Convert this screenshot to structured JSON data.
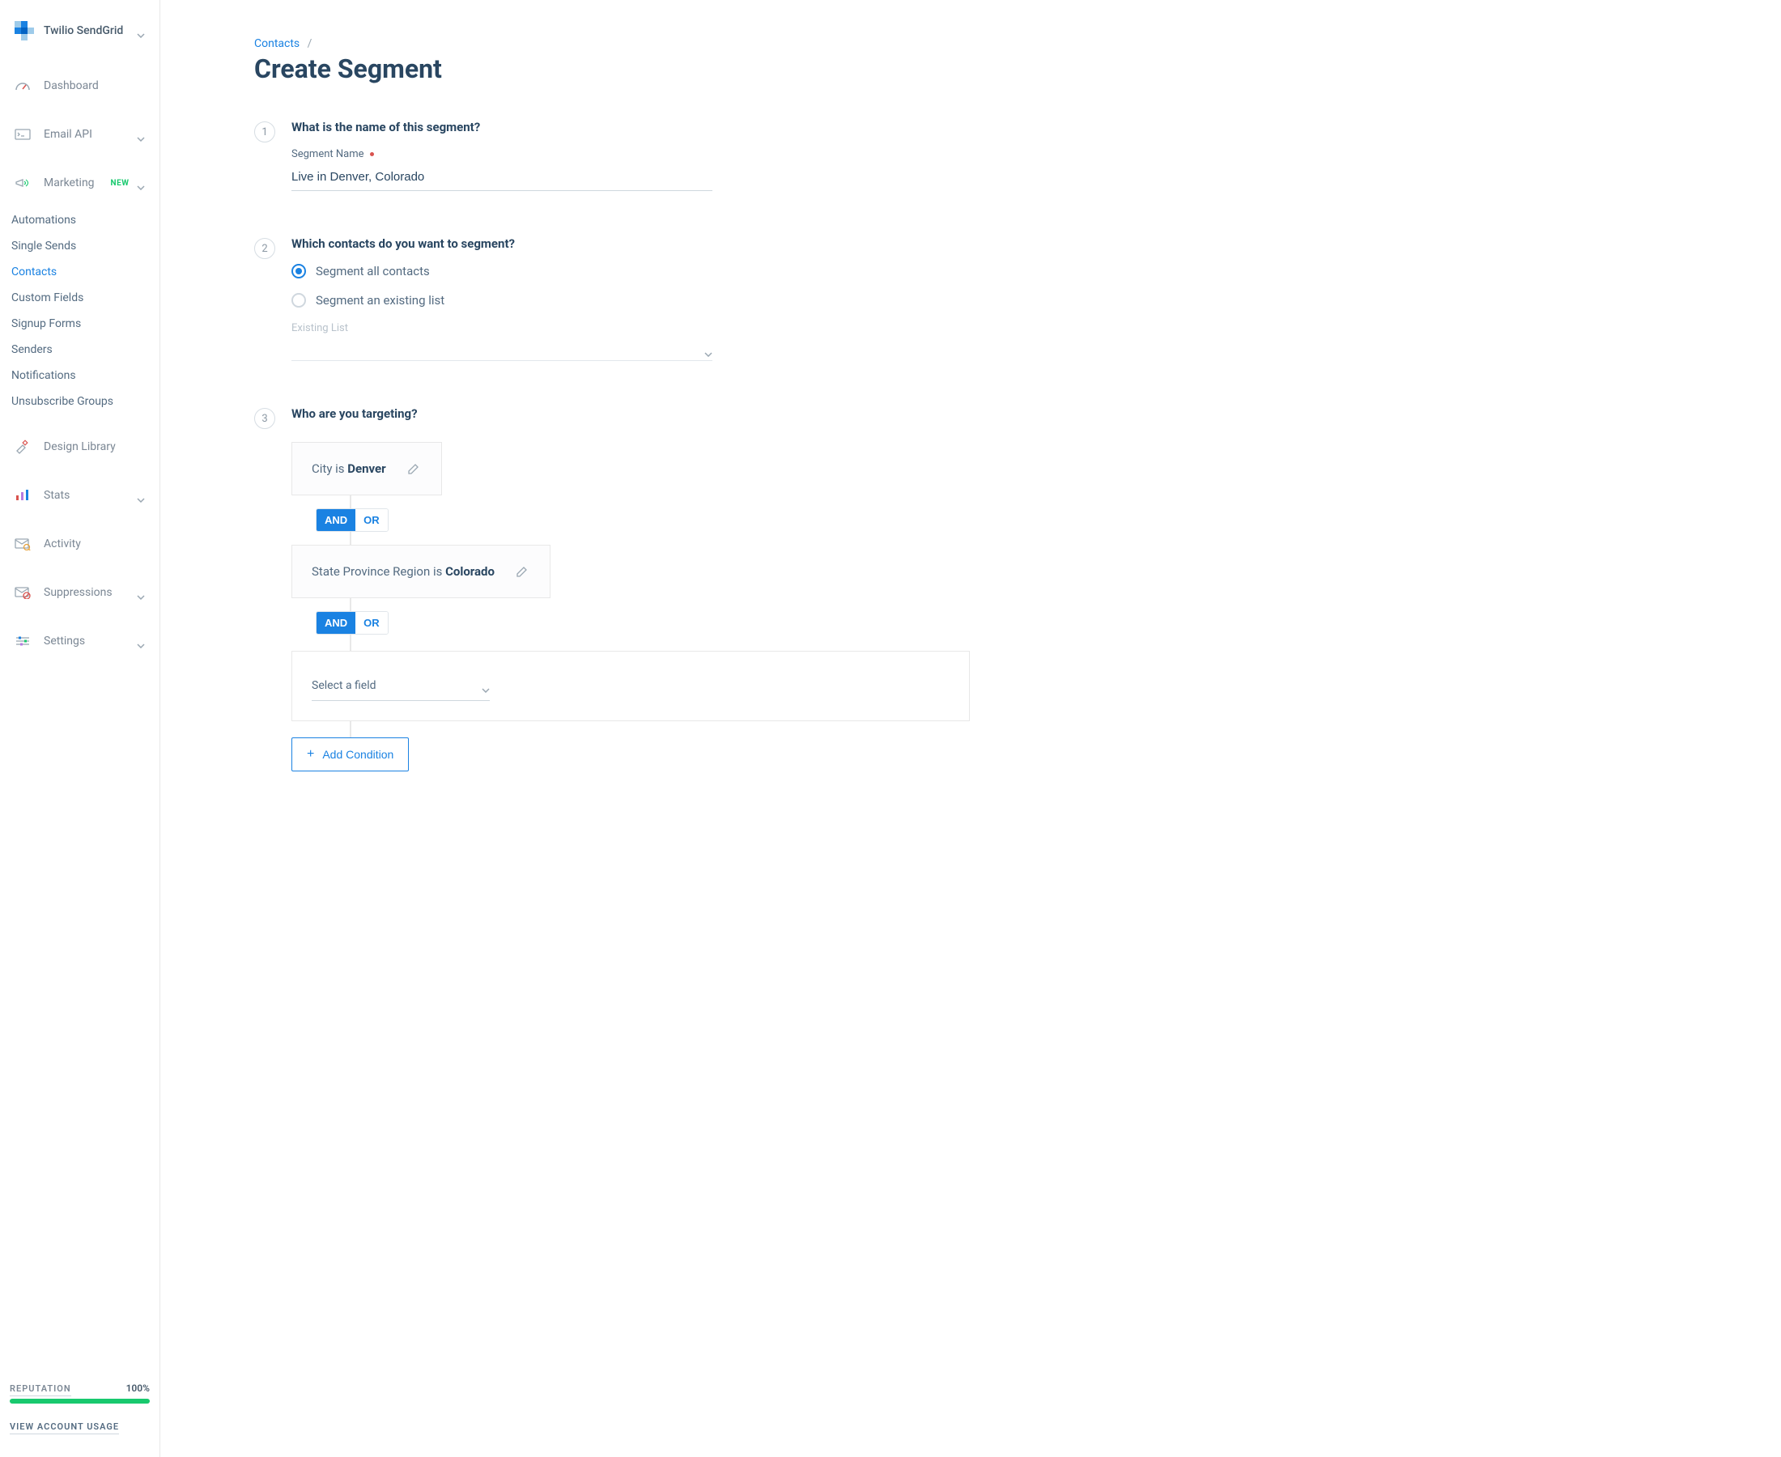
{
  "brand": {
    "name": "Twilio SendGrid"
  },
  "nav": {
    "dashboard": "Dashboard",
    "emailApi": "Email API",
    "marketing": "Marketing",
    "marketingBadge": "NEW",
    "designLibrary": "Design Library",
    "stats": "Stats",
    "activity": "Activity",
    "suppressions": "Suppressions",
    "settings": "Settings"
  },
  "subnav": {
    "automations": "Automations",
    "singleSends": "Single Sends",
    "contacts": "Contacts",
    "customFields": "Custom Fields",
    "signupForms": "Signup Forms",
    "senders": "Senders",
    "notifications": "Notifications",
    "unsubscribeGroups": "Unsubscribe Groups"
  },
  "footer": {
    "reputationLabel": "REPUTATION",
    "reputationPct": "100%",
    "usageLink": "VIEW ACCOUNT USAGE"
  },
  "breadcrumb": {
    "link": "Contacts",
    "sep": "/"
  },
  "pageTitle": "Create Segment",
  "step1": {
    "num": "1",
    "title": "What is the name of this segment?",
    "fieldLabel": "Segment Name",
    "value": "Live in Denver, Colorado"
  },
  "step2": {
    "num": "2",
    "title": "Which contacts do you want to segment?",
    "optAll": "Segment all contacts",
    "optExisting": "Segment an existing list",
    "existingListLabel": "Existing List"
  },
  "step3": {
    "num": "3",
    "title": "Who are you targeting?",
    "cond1_prefix": "City is ",
    "cond1_value": "Denver",
    "cond2_prefix": "State Province Region is ",
    "cond2_value": "Colorado",
    "and": "AND",
    "or": "OR",
    "selectField": "Select a field",
    "addCondition": "Add Condition"
  }
}
